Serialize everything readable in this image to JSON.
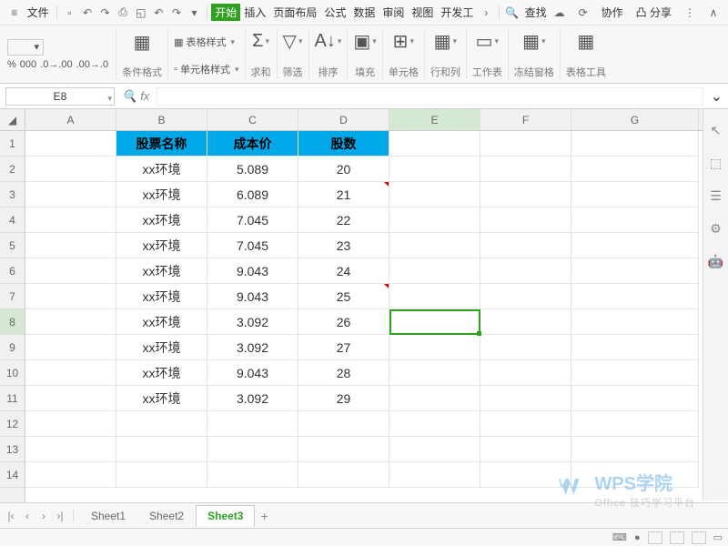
{
  "menu": {
    "file": "文件",
    "tabs": [
      "开始",
      "插入",
      "页面布局",
      "公式",
      "数据",
      "审阅",
      "视图",
      "开发工"
    ],
    "active_tab": 0,
    "search": "查找",
    "collab": "协作",
    "share": "分享"
  },
  "ribbon": {
    "percent": "%",
    "comma": "000",
    "dec_inc": ".0 .00",
    "dec_dec": ".00 .0",
    "cond_fmt": "条件格式",
    "table_style": "表格样式",
    "cell_style": "单元格样式",
    "sum": "求和",
    "filter": "筛选",
    "sort": "排序",
    "fill": "填充",
    "cells": "单元格",
    "rows_cols": "行和列",
    "worksheet": "工作表",
    "freeze": "冻结窗格",
    "table_tools": "表格工具"
  },
  "namebox": {
    "value": "E8",
    "fx": "fx"
  },
  "columns": [
    "A",
    "B",
    "C",
    "D",
    "E",
    "F",
    "G"
  ],
  "rows": [
    1,
    2,
    3,
    4,
    5,
    6,
    7,
    8,
    9,
    10,
    11,
    12,
    13,
    14
  ],
  "active_cell": {
    "col": "E",
    "row": 8
  },
  "header_row": {
    "B": "股票名称",
    "C": "成本价",
    "D": "股数"
  },
  "data_rows": [
    {
      "B": "xx环境",
      "C": "5.089",
      "D": "20",
      "tri": false
    },
    {
      "B": "xx环境",
      "C": "6.089",
      "D": "21",
      "tri": true
    },
    {
      "B": "xx环境",
      "C": "7.045",
      "D": "22",
      "tri": false
    },
    {
      "B": "xx环境",
      "C": "7.045",
      "D": "23",
      "tri": false
    },
    {
      "B": "xx环境",
      "C": "9.043",
      "D": "24",
      "tri": false
    },
    {
      "B": "xx环境",
      "C": "9.043",
      "D": "25",
      "tri": true
    },
    {
      "B": "xx环境",
      "C": "3.092",
      "D": "26",
      "tri": false
    },
    {
      "B": "xx环境",
      "C": "3.092",
      "D": "27",
      "tri": false
    },
    {
      "B": "xx环境",
      "C": "9.043",
      "D": "28",
      "tri": false
    },
    {
      "B": "xx环境",
      "C": "3.092",
      "D": "29",
      "tri": false
    }
  ],
  "sheets": {
    "tabs": [
      "Sheet1",
      "Sheet2",
      "Sheet3"
    ],
    "active": 2
  },
  "watermark": {
    "brand": "WPS学院",
    "sub": "Office 技巧学习平台"
  }
}
